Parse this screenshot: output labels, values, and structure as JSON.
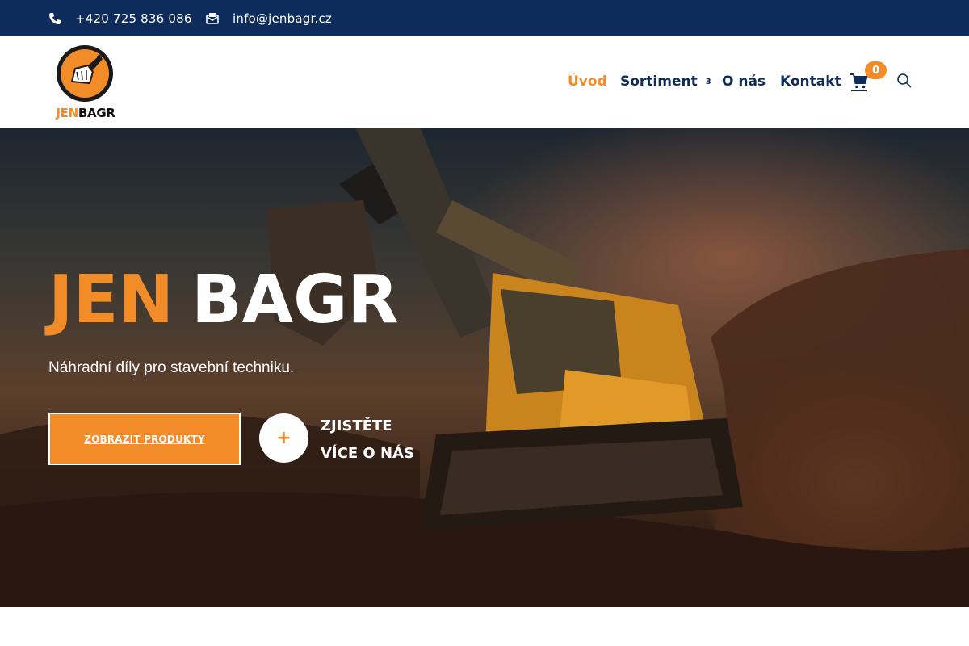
{
  "topbar": {
    "phone": "+420 725 836 086",
    "email": "info@jenbagr.cz",
    "phone_icon": "phone-icon",
    "email_icon": "envelope-icon"
  },
  "logo": {
    "part1": "JEN",
    "part2": "BAGR"
  },
  "nav": {
    "items": [
      {
        "label": "Úvod",
        "active": true
      },
      {
        "label": "Sortiment",
        "has_dropdown": true,
        "dropdown_glyph": "3"
      },
      {
        "label": "O nás"
      },
      {
        "label": "Kontakt"
      }
    ],
    "cart_count": "0",
    "cart_icon": "cart-icon",
    "search_icon": "search-icon"
  },
  "hero": {
    "title_part1": "JEN",
    "title_part2": "BAGR",
    "subtitle": "Náhradní díly pro stavební techniku.",
    "cta_products": "ZOBRAZIT PRODUKTY",
    "plus_glyph": "+",
    "more_line1": "ZJISTĚTE",
    "more_line2": "VÍCE O NÁS"
  },
  "colors": {
    "accent": "#f28c28",
    "navy": "#0e2c5b",
    "white": "#ffffff"
  }
}
